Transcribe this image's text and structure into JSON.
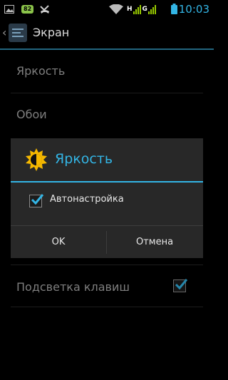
{
  "status_bar": {
    "time": "10:03",
    "badge": "82",
    "network_h": "H",
    "network_g": "G",
    "icons": [
      "image-icon",
      "usb-icon",
      "missed-call-icon",
      "wifi-icon",
      "signal-icon",
      "battery-icon"
    ],
    "accent": "#33b5e5"
  },
  "action_bar": {
    "title": "Экран",
    "icon": "display-settings-icon"
  },
  "settings": {
    "items": [
      {
        "label": "Яркость"
      },
      {
        "label": "Обои"
      },
      {
        "label": "Подсветка клавиш",
        "checked": true
      }
    ]
  },
  "dialog": {
    "title": "Яркость",
    "icon": "sun-icon",
    "auto_label": "Автонастройка",
    "auto_checked": true,
    "ok_label": "OK",
    "cancel_label": "Отмена",
    "accent": "#33b5e5"
  }
}
